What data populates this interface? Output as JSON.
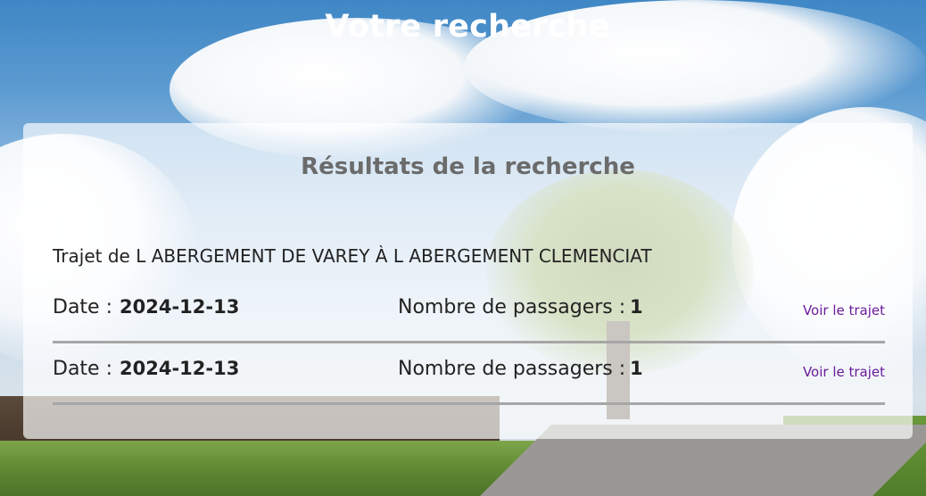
{
  "header": {
    "title": "Votre recherche"
  },
  "results": {
    "heading": "Résultats de la recherche",
    "route_prefix": "Trajet de ",
    "route_from": "L ABERGEMENT DE VAREY",
    "route_sep": " À ",
    "route_to": "L ABERGEMENT CLEMENCIAT",
    "date_label": "Date : ",
    "passengers_label": "Nombre de passagers : ",
    "link_label": "Voir le trajet",
    "items": [
      {
        "date": "2024-12-13",
        "passengers": "1"
      },
      {
        "date": "2024-12-13",
        "passengers": "1"
      }
    ]
  },
  "colors": {
    "link": "#6a1b9a",
    "title": "#ffffff",
    "heading": "#6b6b6b"
  }
}
